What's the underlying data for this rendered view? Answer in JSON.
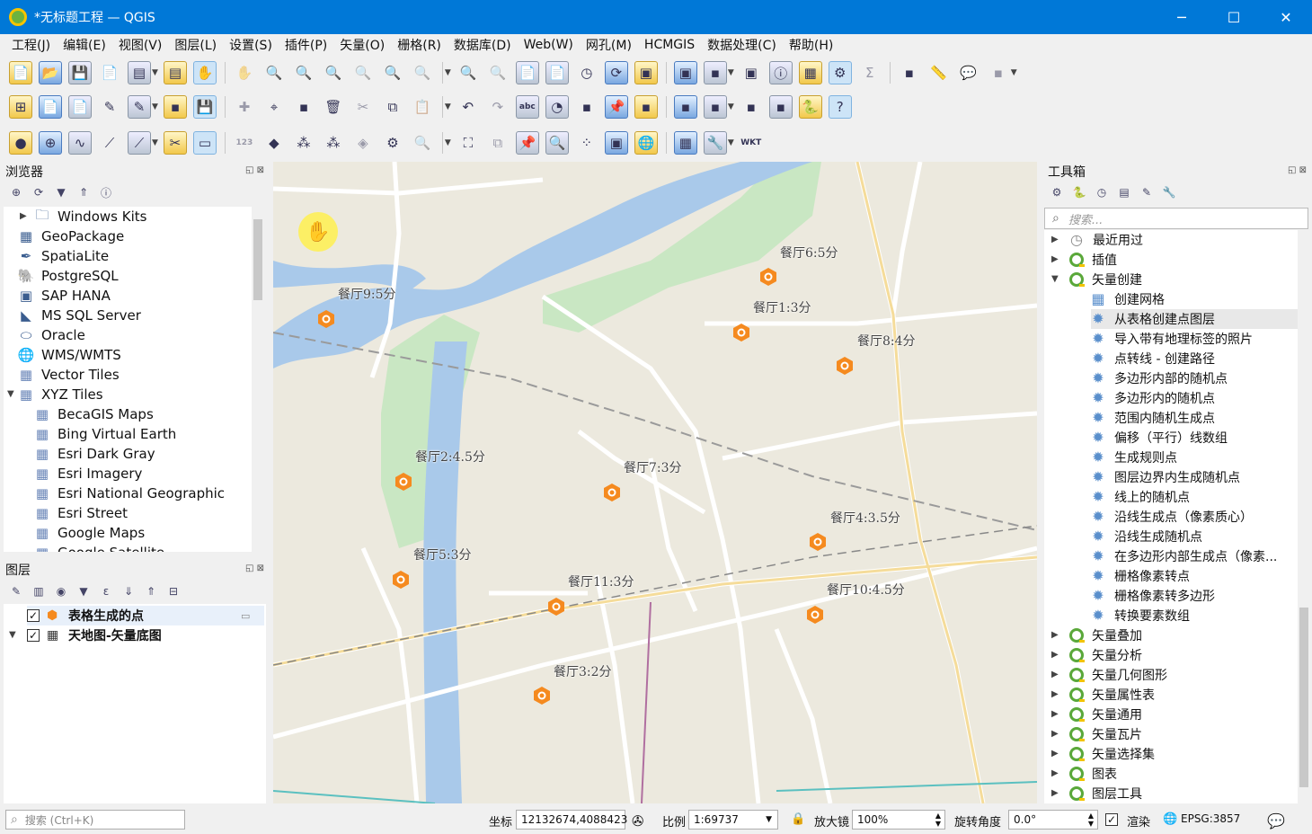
{
  "window": {
    "title": "*无标题工程 — QGIS",
    "minimize": "─",
    "maximize": "☐",
    "close": "✕"
  },
  "menu": [
    "工程(J)",
    "编辑(E)",
    "视图(V)",
    "图层(L)",
    "设置(S)",
    "插件(P)",
    "矢量(O)",
    "栅格(R)",
    "数据库(D)",
    "Web(W)",
    "网孔(M)",
    "HCMGIS",
    "数据处理(C)",
    "帮助(H)"
  ],
  "toolbar_icons": {
    "row1": [
      "new-project-icon",
      "open-project-icon",
      "save-project-icon",
      "new-print-layout-icon",
      "layout-manager-icon",
      "style-manager-icon",
      "pan-icon",
      "pan-to-selection-icon",
      "zoom-in-icon",
      "zoom-out-icon",
      "zoom-full-icon",
      "zoom-to-selection-icon",
      "zoom-to-layer-icon",
      "zoom-native-icon",
      "zoom-last-icon",
      "zoom-next-icon",
      "new-map-view-icon",
      "new-3d-view-icon",
      "temporal-controller-icon",
      "refresh-icon",
      "select-features-icon",
      "select-by-value-icon",
      "deselect-icon",
      "select-by-location-icon",
      "identify-icon",
      "attribute-table-icon",
      "toolbox-icon",
      "statistics-icon",
      "field-calculator-icon",
      "measure-icon",
      "annotation-icon",
      "map-tips-icon"
    ],
    "row2": [
      "data-source-manager-icon",
      "new-geopackage-layer-icon",
      "new-virtual-layer-icon",
      "digitize-icon",
      "edit-icon",
      "toggle-edit-icon",
      "save-edits-icon",
      "add-feature-icon",
      "vertex-tool-icon",
      "modify-attributes-icon",
      "delete-selected-icon",
      "cut-icon",
      "copy-icon",
      "paste-icon",
      "undo-icon",
      "redo-icon",
      "label-tool-icon",
      "diagram-icon",
      "highlight-label-icon",
      "pin-label-icon",
      "show-label-icon",
      "move-label-icon",
      "rotate-label-icon",
      "change-label-icon",
      "plugin-globe-icon",
      "python-icon",
      "help-icon"
    ],
    "row3": [
      "circle-target-icon",
      "crosshair-icon",
      "xy-curve-icon",
      "node-tool-icon",
      "line-tool-icon",
      "split-tool-icon",
      "ruler-icon",
      "number-label-icon",
      "shape-tool-icon",
      "snap-icon",
      "snap-tolerance-icon",
      "layer-stack-icon",
      "settings-icon",
      "search-icon",
      "fullscreen-icon",
      "copy-layer-icon",
      "pin-icon",
      "zoom-point-icon",
      "scatter-icon",
      "extent-icon",
      "globe-icon",
      "grid-icon",
      "wrench-icon",
      "wkt-icon"
    ]
  },
  "browser": {
    "title": "浏览器",
    "items": [
      {
        "label": "Windows Kits",
        "icon": "folder-icon",
        "indent": 1,
        "arrow": "▶"
      },
      {
        "label": "GeoPackage",
        "icon": "geopackage-icon",
        "indent": 0,
        "arrow": ""
      },
      {
        "label": "SpatiaLite",
        "icon": "spatialite-icon",
        "indent": 0,
        "arrow": ""
      },
      {
        "label": "PostgreSQL",
        "icon": "postgresql-icon",
        "indent": 0,
        "arrow": ""
      },
      {
        "label": "SAP HANA",
        "icon": "sap-hana-icon",
        "indent": 0,
        "arrow": ""
      },
      {
        "label": "MS SQL Server",
        "icon": "mssql-icon",
        "indent": 0,
        "arrow": ""
      },
      {
        "label": "Oracle",
        "icon": "oracle-icon",
        "indent": 0,
        "arrow": ""
      },
      {
        "label": "WMS/WMTS",
        "icon": "wms-icon",
        "indent": 0,
        "arrow": ""
      },
      {
        "label": "Vector Tiles",
        "icon": "vector-tiles-icon",
        "indent": 0,
        "arrow": ""
      },
      {
        "label": "XYZ Tiles",
        "icon": "xyz-tiles-icon",
        "indent": 0,
        "arrow": "▼"
      },
      {
        "label": "BecaGIS Maps",
        "icon": "tile-icon",
        "indent": 1,
        "arrow": ""
      },
      {
        "label": "Bing Virtual Earth",
        "icon": "tile-icon",
        "indent": 1,
        "arrow": ""
      },
      {
        "label": "Esri Dark Gray",
        "icon": "tile-icon",
        "indent": 1,
        "arrow": ""
      },
      {
        "label": "Esri Imagery",
        "icon": "tile-icon",
        "indent": 1,
        "arrow": ""
      },
      {
        "label": "Esri National Geographic",
        "icon": "tile-icon",
        "indent": 1,
        "arrow": ""
      },
      {
        "label": "Esri Street",
        "icon": "tile-icon",
        "indent": 1,
        "arrow": ""
      },
      {
        "label": "Google Maps",
        "icon": "tile-icon",
        "indent": 1,
        "arrow": ""
      },
      {
        "label": "Google Satellite",
        "icon": "tile-icon",
        "indent": 1,
        "arrow": ""
      }
    ]
  },
  "layers": {
    "title": "图层",
    "items": [
      {
        "label": "表格生成的点",
        "checked": "✓",
        "icon": "point-layer-icon",
        "arrow": ""
      },
      {
        "label": "天地图-矢量底图",
        "checked": "✓",
        "icon": "raster-layer-icon",
        "arrow": "▼"
      }
    ]
  },
  "map": {
    "points": [
      {
        "label": "餐厅9:5分"
      },
      {
        "label": "餐厅6:5分"
      },
      {
        "label": "餐厅1:3分"
      },
      {
        "label": "餐厅8:4分"
      },
      {
        "label": "餐厅2:4.5分"
      },
      {
        "label": "餐厅7:3分"
      },
      {
        "label": "餐厅4:3.5分"
      },
      {
        "label": "餐厅5:3分"
      },
      {
        "label": "餐厅11:3分"
      },
      {
        "label": "餐厅10:4.5分"
      },
      {
        "label": "餐厅3:2分"
      }
    ],
    "marker_color": "#f58a1f",
    "water_color": "#a8c8e8",
    "park_color": "#c8e6c0"
  },
  "toolbox": {
    "title": "工具箱",
    "search_placeholder": "搜索...",
    "items": [
      {
        "label": "最近用过",
        "kind": "clock",
        "arrow": "▶",
        "child": false
      },
      {
        "label": "插值",
        "kind": "q",
        "arrow": "▶",
        "child": false
      },
      {
        "label": "矢量创建",
        "kind": "q",
        "arrow": "▼",
        "child": false
      },
      {
        "label": "创建网格",
        "kind": "g",
        "arrow": "",
        "child": true
      },
      {
        "label": "从表格创建点图层",
        "kind": "g",
        "arrow": "",
        "child": true
      },
      {
        "label": "导入带有地理标签的照片",
        "kind": "g",
        "arrow": "",
        "child": true
      },
      {
        "label": "点转线 - 创建路径",
        "kind": "g",
        "arrow": "",
        "child": true
      },
      {
        "label": "多边形内部的随机点",
        "kind": "g",
        "arrow": "",
        "child": true
      },
      {
        "label": "多边形内的随机点",
        "kind": "g",
        "arrow": "",
        "child": true
      },
      {
        "label": "范围内随机生成点",
        "kind": "g",
        "arrow": "",
        "child": true
      },
      {
        "label": "偏移（平行）线数组",
        "kind": "g",
        "arrow": "",
        "child": true
      },
      {
        "label": "生成规则点",
        "kind": "g",
        "arrow": "",
        "child": true
      },
      {
        "label": "图层边界内生成随机点",
        "kind": "g",
        "arrow": "",
        "child": true
      },
      {
        "label": "线上的随机点",
        "kind": "g",
        "arrow": "",
        "child": true
      },
      {
        "label": "沿线生成点（像素质心）",
        "kind": "g",
        "arrow": "",
        "child": true
      },
      {
        "label": "沿线生成随机点",
        "kind": "g",
        "arrow": "",
        "child": true
      },
      {
        "label": "在多边形内部生成点（像素...",
        "kind": "g",
        "arrow": "",
        "child": true
      },
      {
        "label": "栅格像素转点",
        "kind": "g",
        "arrow": "",
        "child": true
      },
      {
        "label": "栅格像素转多边形",
        "kind": "g",
        "arrow": "",
        "child": true
      },
      {
        "label": "转换要素数组",
        "kind": "g",
        "arrow": "",
        "child": true
      },
      {
        "label": "矢量叠加",
        "kind": "q",
        "arrow": "▶",
        "child": false
      },
      {
        "label": "矢量分析",
        "kind": "q",
        "arrow": "▶",
        "child": false
      },
      {
        "label": "矢量几何图形",
        "kind": "q",
        "arrow": "▶",
        "child": false
      },
      {
        "label": "矢量属性表",
        "kind": "q",
        "arrow": "▶",
        "child": false
      },
      {
        "label": "矢量通用",
        "kind": "q",
        "arrow": "▶",
        "child": false
      },
      {
        "label": "矢量瓦片",
        "kind": "q",
        "arrow": "▶",
        "child": false
      },
      {
        "label": "矢量选择集",
        "kind": "q",
        "arrow": "▶",
        "child": false
      },
      {
        "label": "图表",
        "kind": "q",
        "arrow": "▶",
        "child": false
      },
      {
        "label": "图层工具",
        "kind": "q",
        "arrow": "▶",
        "child": false
      }
    ]
  },
  "statusbar": {
    "search_placeholder": "搜索 (Ctrl+K)",
    "coord_label": "坐标",
    "coord_value": "12132674,4088423",
    "scale_label": "比例",
    "scale_value": "1:69737",
    "magnifier_label": "放大镜",
    "magnifier_value": "100%",
    "rotation_label": "旋转角度",
    "rotation_value": "0.0°",
    "render_label": "渲染",
    "render_checked": "✓",
    "crs": "EPSG:3857"
  }
}
